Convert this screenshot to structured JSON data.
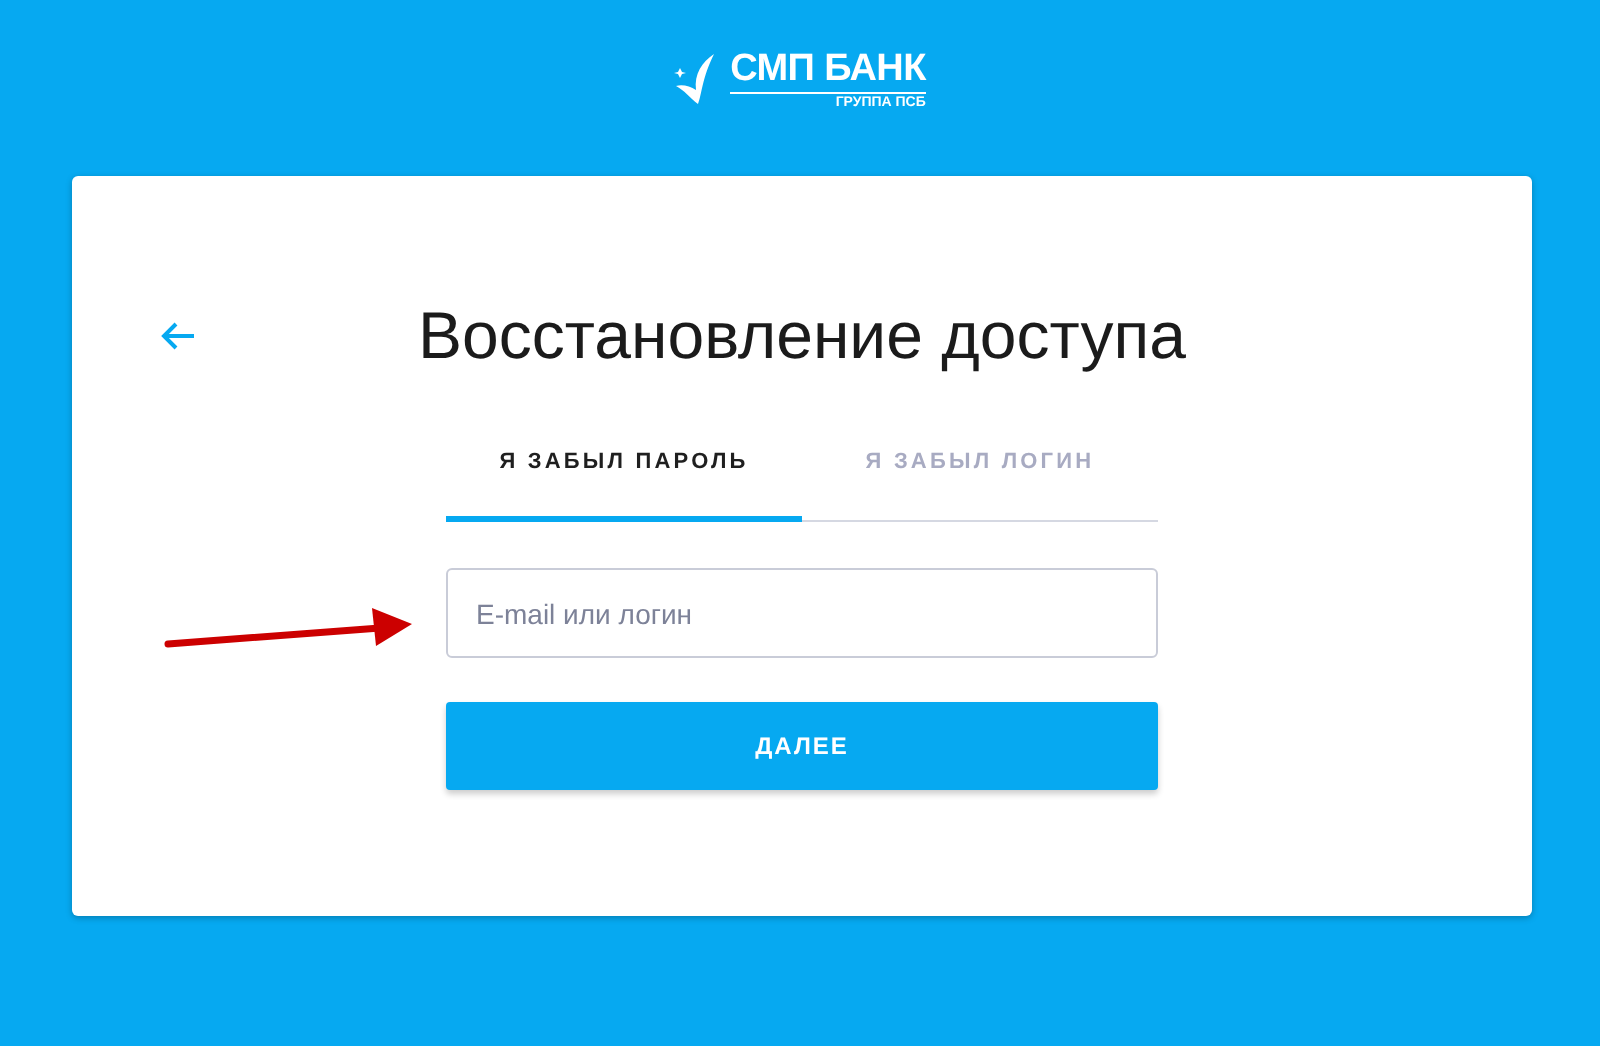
{
  "logo": {
    "name": "СМП БАНК",
    "subtitle": "ГРУППА ПСБ"
  },
  "title": "Восстановление доступа",
  "tabs": [
    {
      "label": "Я ЗАБЫЛ ПАРОЛЬ",
      "selected": true
    },
    {
      "label": "Я ЗАБЫЛ ЛОГИН",
      "selected": false
    }
  ],
  "login_field": {
    "placeholder": "E-mail или логин"
  },
  "submit_button": "ДАЛЕЕ"
}
